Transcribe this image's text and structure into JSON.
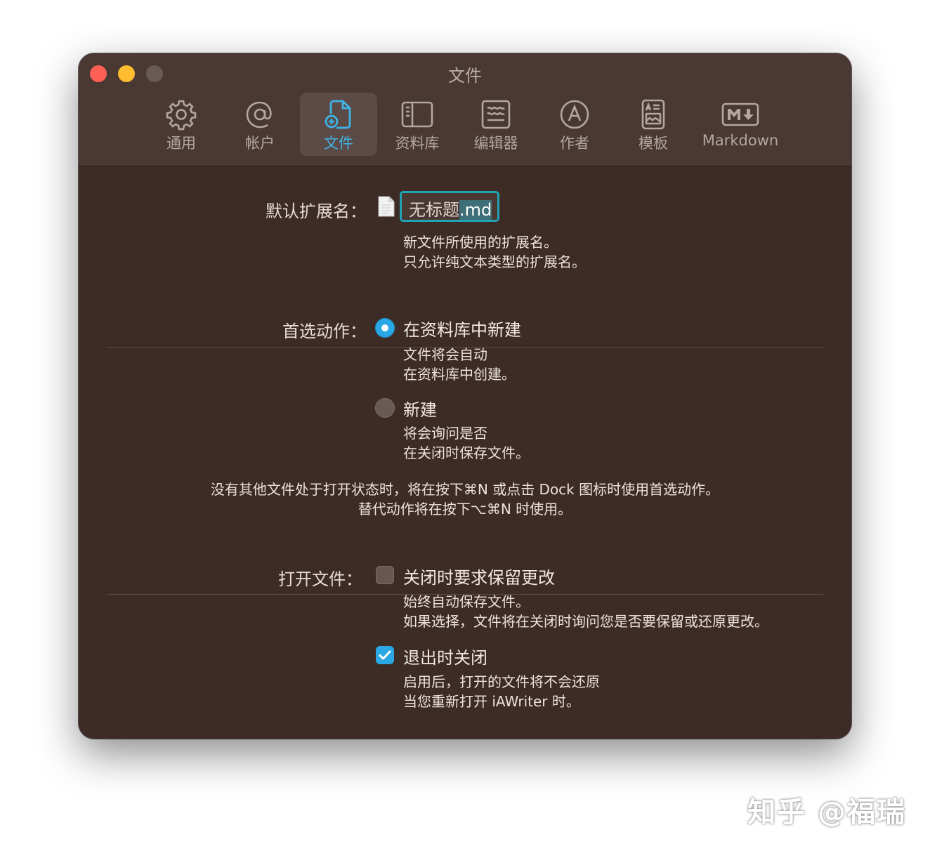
{
  "window": {
    "title": "文件"
  },
  "toolbar": {
    "items": [
      {
        "label": "通用",
        "icon": "gear-icon"
      },
      {
        "label": "帐户",
        "icon": "at-icon"
      },
      {
        "label": "文件",
        "icon": "new-document-icon",
        "active": true
      },
      {
        "label": "资料库",
        "icon": "sidebar-icon"
      },
      {
        "label": "编辑器",
        "icon": "editor-icon"
      },
      {
        "label": "作者",
        "icon": "author-icon"
      },
      {
        "label": "模板",
        "icon": "template-icon"
      },
      {
        "label": "Markdown",
        "icon": "markdown-icon"
      }
    ]
  },
  "extension": {
    "label": "默认扩展名：",
    "file_base": "无标题",
    "file_ext": ".md",
    "desc_line1": "新文件所使用的扩展名。",
    "desc_line2": "只允许纯文本类型的扩展名。"
  },
  "preferred_action": {
    "label": "首选动作：",
    "options": [
      {
        "label": "在资料库中新建",
        "selected": true,
        "desc_line1": "文件将会自动",
        "desc_line2": "在资料库中创建。"
      },
      {
        "label": "新建",
        "selected": false,
        "desc_line1": "将会询问是否",
        "desc_line2": "在关闭时保存文件。"
      }
    ],
    "note_line1": "没有其他文件处于打开状态时，将在按下⌘N 或点击 Dock 图标时使用首选动作。",
    "note_line2": "替代动作将在按下⌥⌘N 时使用。"
  },
  "open_files": {
    "label": "打开文件：",
    "options": [
      {
        "label": "关闭时要求保留更改",
        "checked": false,
        "desc_line1": "始终自动保存文件。",
        "desc_line2": "如果选择，文件将在关闭时询问您是否要保留或还原更改。"
      },
      {
        "label": "退出时关闭",
        "checked": true,
        "desc_line1": "启用后，打开的文件将不会还原",
        "desc_line2": "当您重新打开 iAWriter 时。"
      }
    ]
  },
  "watermark": "知乎 @福瑞",
  "colors": {
    "accent": "#2aa7e5",
    "background": "#3d2b25",
    "titlebar": "#4a3833",
    "focus_ring": "#20a3b5"
  }
}
